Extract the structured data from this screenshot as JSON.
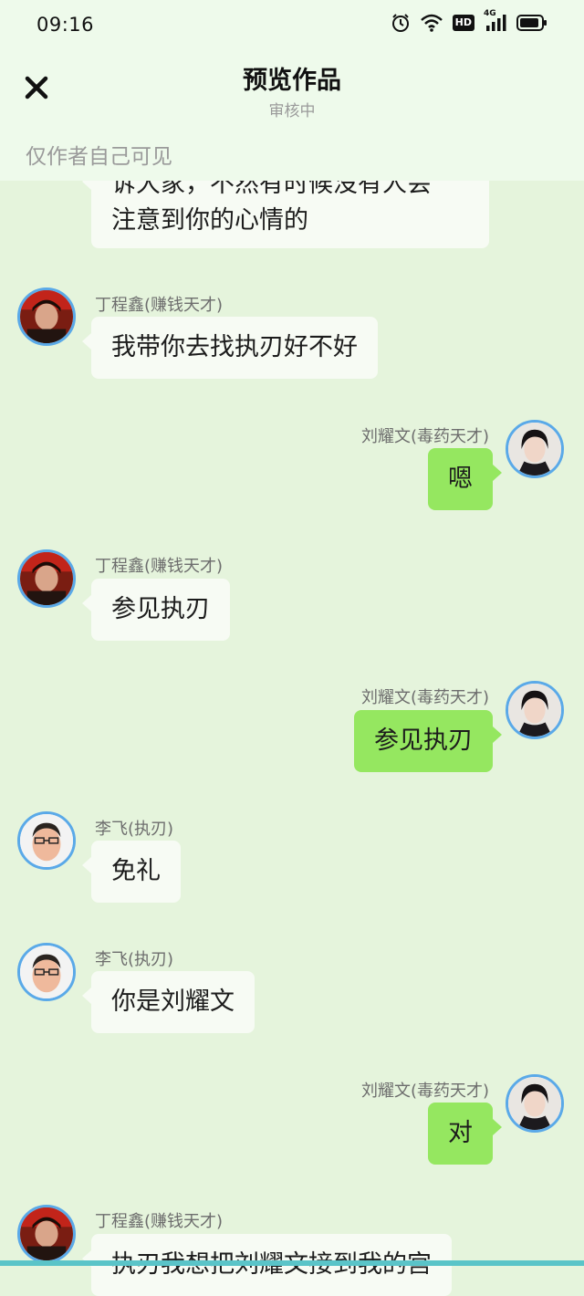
{
  "status_bar": {
    "time": "09:16",
    "icons": [
      "alarm-icon",
      "wifi-icon",
      "hd-icon",
      "signal-4g-icon",
      "battery-icon"
    ],
    "hd_label": "HD",
    "network_label": "4G"
  },
  "header": {
    "title": "预览作品",
    "subtitle": "审核中",
    "privacy_note": "仅作者自己可见"
  },
  "messages": [
    {
      "side": "left",
      "sender": "",
      "text_lines": [
        "诉大家，不然有时候没有人会",
        "注意到你的心情的"
      ]
    },
    {
      "side": "left",
      "sender": "丁程鑫(赚钱天才)",
      "text": "我带你去找执刃好不好"
    },
    {
      "side": "right",
      "sender": "刘耀文(毒药天才)",
      "text": "嗯"
    },
    {
      "side": "left",
      "sender": "丁程鑫(赚钱天才)",
      "text": "参见执刃"
    },
    {
      "side": "right",
      "sender": "刘耀文(毒药天才)",
      "text": "参见执刃"
    },
    {
      "side": "left",
      "sender": "李飞(执刃)",
      "text": "免礼"
    },
    {
      "side": "left",
      "sender": "李飞(执刃)",
      "text": "你是刘耀文"
    },
    {
      "side": "right",
      "sender": "刘耀文(毒药天才)",
      "text": "对"
    },
    {
      "side": "left",
      "sender": "丁程鑫(赚钱天才)",
      "text": "执刃我想把刘耀文接到我的宫"
    }
  ],
  "colors": {
    "background": "#e5f4dc",
    "header_bg": "#eefaeb",
    "right_bubble": "#95e760",
    "left_bubble": "#f7fbf4",
    "avatar_border": "#5aa9e8"
  }
}
